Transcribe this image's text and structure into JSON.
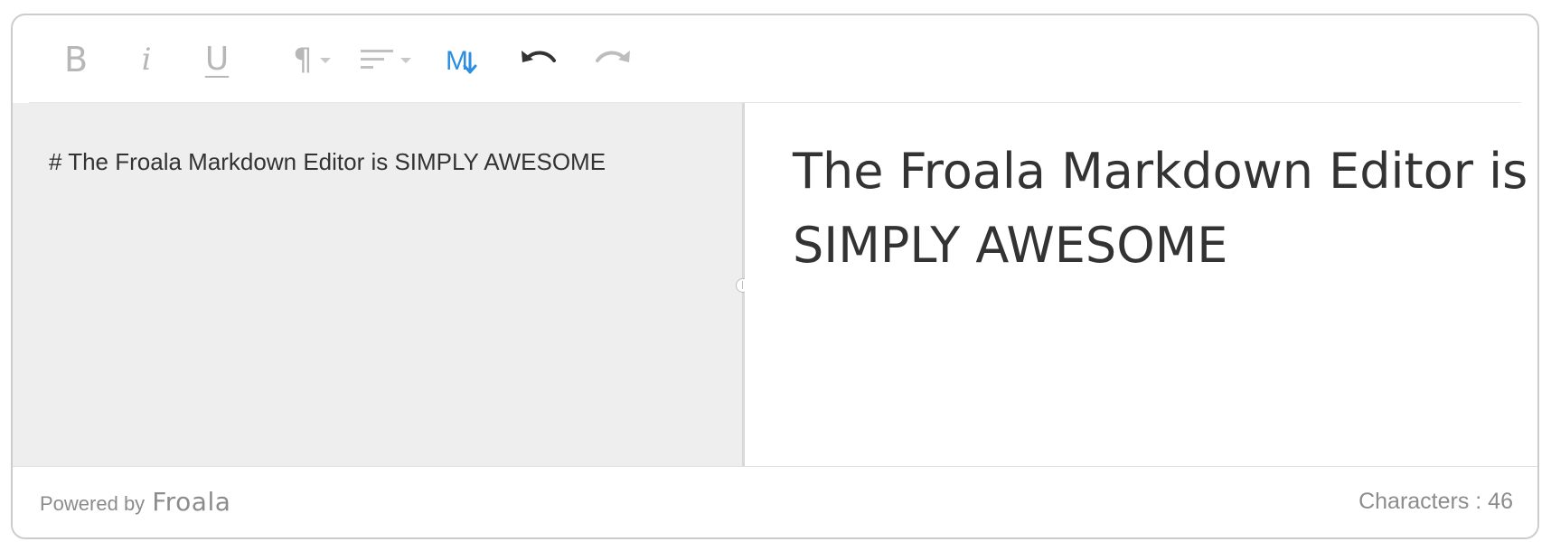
{
  "toolbar": {
    "buttons": [
      {
        "id": "bold",
        "label": "B",
        "icon": "bold-icon",
        "state": "disabled"
      },
      {
        "id": "italic",
        "label": "i",
        "icon": "italic-icon",
        "state": "disabled"
      },
      {
        "id": "underline",
        "label": "U",
        "icon": "underline-icon",
        "state": "disabled"
      },
      {
        "id": "paragraph-format",
        "label": "¶",
        "icon": "paragraph-icon",
        "state": "disabled",
        "dropdown": true
      },
      {
        "id": "align",
        "icon": "align-left-icon",
        "state": "disabled",
        "dropdown": true
      },
      {
        "id": "markdown",
        "icon": "markdown-icon",
        "state": "active"
      },
      {
        "id": "undo",
        "icon": "undo-icon",
        "state": "enabled"
      },
      {
        "id": "redo",
        "icon": "redo-icon",
        "state": "disabled"
      }
    ]
  },
  "editor": {
    "markdown_source": "# The Froala Markdown Editor is SIMPLY AWESOME",
    "preview_heading": "The Froala Markdown Editor is SIMPLY AWESOME"
  },
  "footer": {
    "powered_label": "Powered by",
    "powered_brand": "Froala",
    "char_counter": "Characters : 46"
  },
  "colors": {
    "accent": "#2b8ee0",
    "icon_active": "#333333",
    "icon_disabled": "#b7b7b7",
    "source_pane_bg": "#eeeeee",
    "text": "#333333",
    "muted_text": "#8c8c8c",
    "border": "#cccccc"
  }
}
